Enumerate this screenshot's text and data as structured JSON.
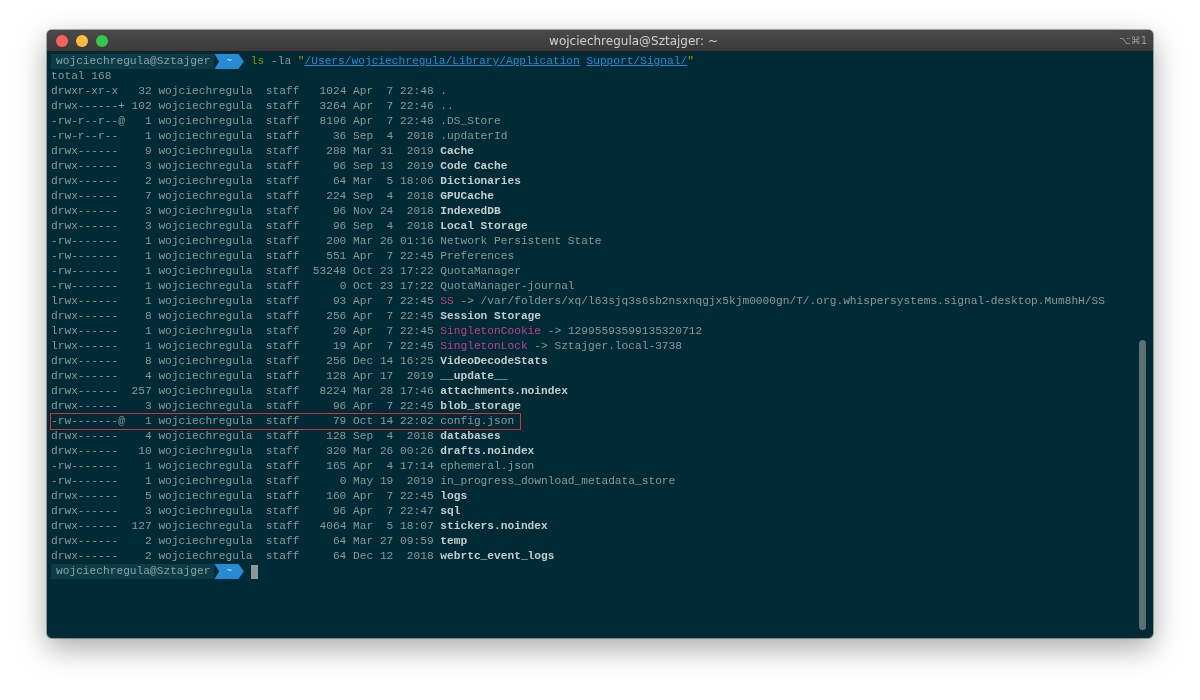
{
  "window": {
    "title": "wojciechregula@Sztajger: ~",
    "shortcut": "⌥⌘1"
  },
  "terminal": {
    "prompt": {
      "user": "wojciechregula@Sztajger",
      "dir": "~"
    },
    "command": {
      "program": "ls",
      "flags": "-la",
      "open_quote": "\"",
      "path_parts": [
        "/Users/wojciechregula/Library/Application",
        "Support/Signal/"
      ],
      "close_quote": "\""
    },
    "total": "total 168",
    "entries": [
      {
        "perms": "drwxr-xr-x",
        "links": "32",
        "owner": "wojciechregula",
        "group": "staff",
        "size": "1024",
        "date": "Apr  7 22:48",
        "name": ".",
        "kind": "plain",
        "highlighted": false
      },
      {
        "perms": "drwx------+",
        "links": "102",
        "owner": "wojciechregula",
        "group": "staff",
        "size": "3264",
        "date": "Apr  7 22:46",
        "name": "..",
        "kind": "plain",
        "highlighted": false
      },
      {
        "perms": "-rw-r--r--@",
        "links": "1",
        "owner": "wojciechregula",
        "group": "staff",
        "size": "8196",
        "date": "Apr  7 22:48",
        "name": ".DS_Store",
        "kind": "plain",
        "highlighted": false
      },
      {
        "perms": "-rw-r--r--",
        "links": "1",
        "owner": "wojciechregula",
        "group": "staff",
        "size": "36",
        "date": "Sep  4  2018",
        "name": ".updaterId",
        "kind": "plain",
        "highlighted": false
      },
      {
        "perms": "drwx------",
        "links": "9",
        "owner": "wojciechregula",
        "group": "staff",
        "size": "288",
        "date": "Mar 31  2019",
        "name": "Cache",
        "kind": "dir",
        "highlighted": false
      },
      {
        "perms": "drwx------",
        "links": "3",
        "owner": "wojciechregula",
        "group": "staff",
        "size": "96",
        "date": "Sep 13  2019",
        "name": "Code Cache",
        "kind": "dir",
        "highlighted": false
      },
      {
        "perms": "drwx------",
        "links": "2",
        "owner": "wojciechregula",
        "group": "staff",
        "size": "64",
        "date": "Mar  5 18:06",
        "name": "Dictionaries",
        "kind": "dir",
        "highlighted": false
      },
      {
        "perms": "drwx------",
        "links": "7",
        "owner": "wojciechregula",
        "group": "staff",
        "size": "224",
        "date": "Sep  4  2018",
        "name": "GPUCache",
        "kind": "dir",
        "highlighted": false
      },
      {
        "perms": "drwx------",
        "links": "3",
        "owner": "wojciechregula",
        "group": "staff",
        "size": "96",
        "date": "Nov 24  2018",
        "name": "IndexedDB",
        "kind": "dir",
        "highlighted": false
      },
      {
        "perms": "drwx------",
        "links": "3",
        "owner": "wojciechregula",
        "group": "staff",
        "size": "96",
        "date": "Sep  4  2018",
        "name": "Local Storage",
        "kind": "dir",
        "highlighted": false
      },
      {
        "perms": "-rw-------",
        "links": "1",
        "owner": "wojciechregula",
        "group": "staff",
        "size": "200",
        "date": "Mar 26 01:16",
        "name": "Network Persistent State",
        "kind": "plain",
        "highlighted": false
      },
      {
        "perms": "-rw-------",
        "links": "1",
        "owner": "wojciechregula",
        "group": "staff",
        "size": "551",
        "date": "Apr  7 22:45",
        "name": "Preferences",
        "kind": "plain",
        "highlighted": false
      },
      {
        "perms": "-rw-------",
        "links": "1",
        "owner": "wojciechregula",
        "group": "staff",
        "size": "53248",
        "date": "Oct 23 17:22",
        "name": "QuotaManager",
        "kind": "plain",
        "highlighted": false
      },
      {
        "perms": "-rw-------",
        "links": "1",
        "owner": "wojciechregula",
        "group": "staff",
        "size": "0",
        "date": "Oct 23 17:22",
        "name": "QuotaManager-journal",
        "kind": "plain",
        "highlighted": false
      },
      {
        "perms": "lrwx------",
        "links": "1",
        "owner": "wojciechregula",
        "group": "staff",
        "size": "93",
        "date": "Apr  7 22:45",
        "name": "SS",
        "kind": "symlink",
        "arrow": "->",
        "target": "/var/folders/xq/l63sjq3s6sb2nsxnqgjx5kjm0000gn/T/.org.whispersystems.signal-desktop.Mum8hH/SS",
        "highlighted": false
      },
      {
        "perms": "drwx------",
        "links": "8",
        "owner": "wojciechregula",
        "group": "staff",
        "size": "256",
        "date": "Apr  7 22:45",
        "name": "Session Storage",
        "kind": "dir",
        "highlighted": false
      },
      {
        "perms": "lrwx------",
        "links": "1",
        "owner": "wojciechregula",
        "group": "staff",
        "size": "20",
        "date": "Apr  7 22:45",
        "name": "SingletonCookie",
        "kind": "symlink",
        "arrow": "->",
        "target": "12995593599135320712",
        "highlighted": false
      },
      {
        "perms": "lrwx------",
        "links": "1",
        "owner": "wojciechregula",
        "group": "staff",
        "size": "19",
        "date": "Apr  7 22:45",
        "name": "SingletonLock",
        "kind": "symlink",
        "arrow": "->",
        "target": "Sztajger.local-3738",
        "highlighted": false
      },
      {
        "perms": "drwx------",
        "links": "8",
        "owner": "wojciechregula",
        "group": "staff",
        "size": "256",
        "date": "Dec 14 16:25",
        "name": "VideoDecodeStats",
        "kind": "dir",
        "highlighted": false
      },
      {
        "perms": "drwx------",
        "links": "4",
        "owner": "wojciechregula",
        "group": "staff",
        "size": "128",
        "date": "Apr 17  2019",
        "name": "__update__",
        "kind": "dir",
        "highlighted": false
      },
      {
        "perms": "drwx------",
        "links": "257",
        "owner": "wojciechregula",
        "group": "staff",
        "size": "8224",
        "date": "Mar 28 17:46",
        "name": "attachments.noindex",
        "kind": "dir",
        "highlighted": false
      },
      {
        "perms": "drwx------",
        "links": "3",
        "owner": "wojciechregula",
        "group": "staff",
        "size": "96",
        "date": "Apr  7 22:45",
        "name": "blob_storage",
        "kind": "dir",
        "highlighted": false
      },
      {
        "perms": "-rw-------@",
        "links": "1",
        "owner": "wojciechregula",
        "group": "staff",
        "size": "79",
        "date": "Oct 14 22:02",
        "name": "config.json",
        "kind": "plain",
        "highlighted": true
      },
      {
        "perms": "drwx------",
        "links": "4",
        "owner": "wojciechregula",
        "group": "staff",
        "size": "128",
        "date": "Sep  4  2018",
        "name": "databases",
        "kind": "dir",
        "highlighted": false
      },
      {
        "perms": "drwx------",
        "links": "10",
        "owner": "wojciechregula",
        "group": "staff",
        "size": "320",
        "date": "Mar 26 00:26",
        "name": "drafts.noindex",
        "kind": "dir",
        "highlighted": false
      },
      {
        "perms": "-rw-------",
        "links": "1",
        "owner": "wojciechregula",
        "group": "staff",
        "size": "165",
        "date": "Apr  4 17:14",
        "name": "ephemeral.json",
        "kind": "plain",
        "highlighted": false
      },
      {
        "perms": "-rw-------",
        "links": "1",
        "owner": "wojciechregula",
        "group": "staff",
        "size": "0",
        "date": "May 19  2019",
        "name": "in_progress_download_metadata_store",
        "kind": "plain",
        "highlighted": false
      },
      {
        "perms": "drwx------",
        "links": "5",
        "owner": "wojciechregula",
        "group": "staff",
        "size": "160",
        "date": "Apr  7 22:45",
        "name": "logs",
        "kind": "dir",
        "highlighted": false
      },
      {
        "perms": "drwx------",
        "links": "3",
        "owner": "wojciechregula",
        "group": "staff",
        "size": "96",
        "date": "Apr  7 22:47",
        "name": "sql",
        "kind": "dir",
        "highlighted": false
      },
      {
        "perms": "drwx------",
        "links": "127",
        "owner": "wojciechregula",
        "group": "staff",
        "size": "4064",
        "date": "Mar  5 18:07",
        "name": "stickers.noindex",
        "kind": "dir",
        "highlighted": false
      },
      {
        "perms": "drwx------",
        "links": "2",
        "owner": "wojciechregula",
        "group": "staff",
        "size": "64",
        "date": "Mar 27 09:59",
        "name": "temp",
        "kind": "dir",
        "highlighted": false
      },
      {
        "perms": "drwx------",
        "links": "2",
        "owner": "wojciechregula",
        "group": "staff",
        "size": "64",
        "date": "Dec 12  2018",
        "name": "webrtc_event_logs",
        "kind": "dir",
        "highlighted": false
      }
    ],
    "final_prompt": {
      "user": "wojciechregula@Sztajger",
      "dir": "~"
    }
  }
}
